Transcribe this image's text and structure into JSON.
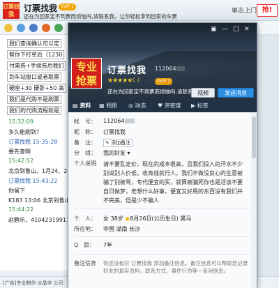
{
  "chat_window": {
    "logo_text": "订票找我",
    "title": "订票找我",
    "vip_badge": "SVIP 1",
    "header_message": "还在为回家定不到票而烦恼吗,请联系我，让你轻松拿到回家的车票",
    "ad_text": "单击上门",
    "grab_button": "抢!",
    "history": [
      {
        "text": "我们查询确认可以定",
        "style": "box"
      },
      {
        "text": "帮你下打单后（1230",
        "style": "box"
      },
      {
        "text": "付票费+手续费后我们",
        "style": "box"
      },
      {
        "text": "到车站窗口或者取票",
        "style": "box"
      },
      {
        "text": "硬座+30  硬卧+50  高",
        "style": "box"
      },
      {
        "text": "我们是代购不是刷票",
        "style": "box"
      },
      {
        "text": "我们的代购流程就是",
        "style": "box"
      },
      {
        "text": "15:32:09",
        "style": "green"
      },
      {
        "text": "多久能刷到？",
        "style": "plain"
      },
      {
        "text": "订票找我  15:35:28",
        "style": "blue"
      },
      {
        "text": "要先查啊",
        "style": "plain"
      },
      {
        "text": "15:42:52",
        "style": "green"
      },
      {
        "text": "北京到鲁山，1月24、25",
        "style": "plain"
      },
      {
        "text": "订票找我  15:43:22",
        "style": "blue"
      },
      {
        "text": "你留下",
        "style": "plain"
      },
      {
        "text": "K183 13:06 北京到鲁山",
        "style": "plain"
      },
      {
        "text": "15:44:22",
        "style": "green"
      },
      {
        "text": "赵鹏乐，41042319911010",
        "style": "plain"
      }
    ],
    "footer": "[广告]专业制作 水晶字 公司"
  },
  "profile": {
    "logo_text": "专业抢票",
    "nickname": "订票找我",
    "qq_number": "112064",
    "stars": "★★★★★☾☾",
    "svip": "SVIP 1",
    "mood": "还在为回家定不到票而烦恼吗,请联系我...",
    "buttons": {
      "video": "视频",
      "message": "发送消息"
    },
    "tabs": [
      "资料",
      "相册",
      "动态",
      "亲密度",
      "标签"
    ],
    "fields": {
      "account_label": "帐　号：",
      "nickname_label": "昵　称：",
      "nickname_value": "订票找我",
      "remark_label": "备　注：",
      "add_remark": "添加备注",
      "group_label": "分　组：",
      "group_value": "我的好友",
      "signature_label": "个人说明",
      "signature": "请不要乱定价，现在的成本很高，且我们投入的汗水不少别说别人价低，收肯线就行人，我们不做没良心的生意被骗了别被骂，专代便宜的买，就算被骗死你也是活该不要自日做梦，老想什么好事，便宜又好用的东西没有我们并不完美，但是少不骗人",
      "personal_label": "个　人：",
      "personal_value": "女  38岁",
      "birthday": "8月26日(公历生日)",
      "zodiac": "属马",
      "location_label": "所在地：",
      "location_value": "中国 湖南 长沙",
      "qage_label": "Q　龄：",
      "qage_value": "7年",
      "remark_info_label": "备注信息",
      "remark_info": "你还没有对 订票找我 添加备注信息。备注信息可以帮助您记录好友的真实资料、联系方式、事件行为等一系列信息。"
    }
  }
}
